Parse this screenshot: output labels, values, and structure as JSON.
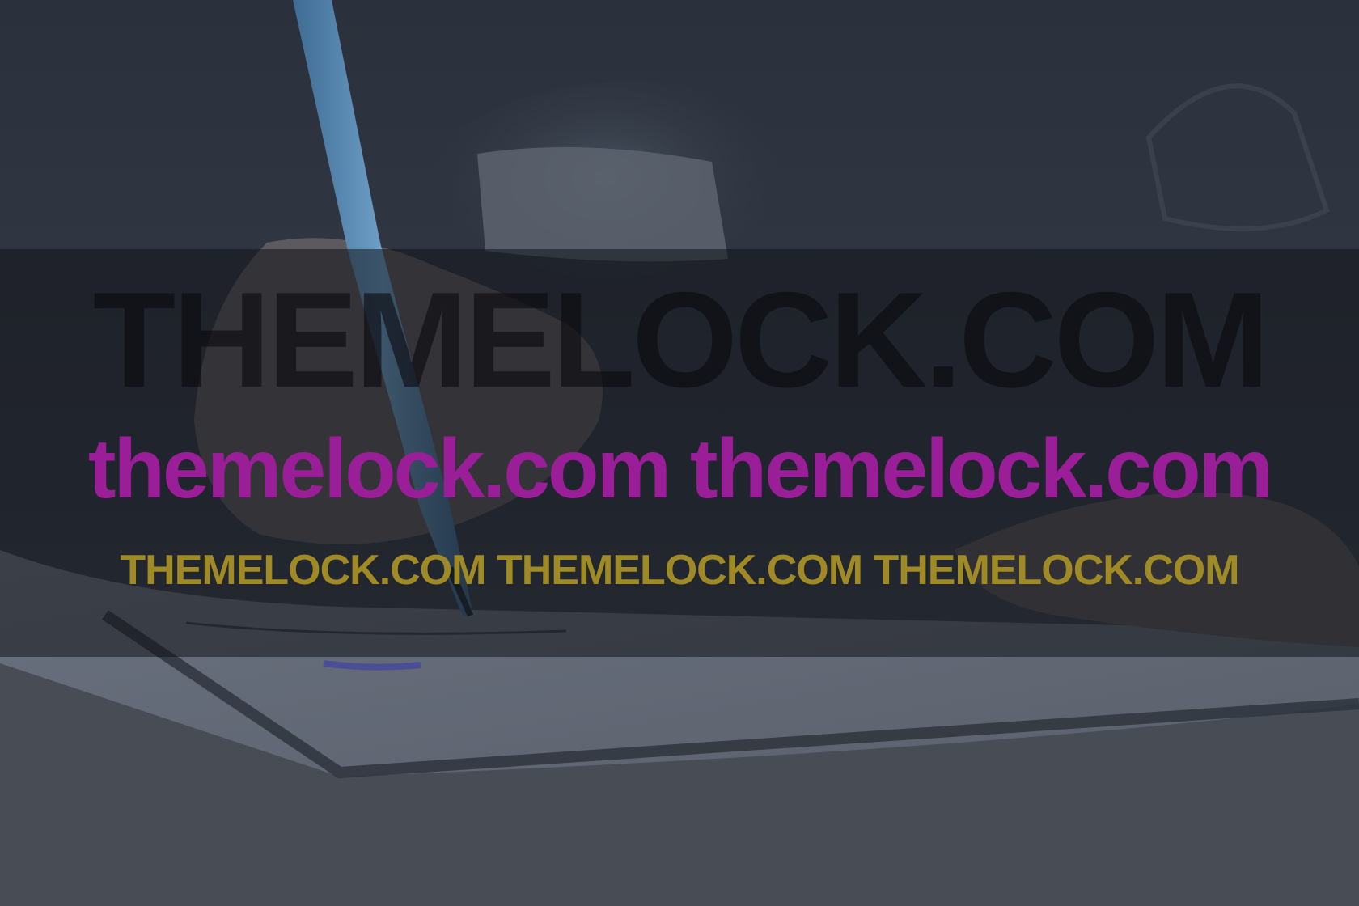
{
  "watermark": {
    "line_1": "THEMELOCK.COM",
    "line_2": "themelock.com themelock.com",
    "line_3": "THEMELOCK.COM THEMELOCK.COM THEMELOCK.COM",
    "colors": {
      "line_1": "#0b0b0e",
      "line_2": "#9b1e99",
      "line_3": "#a08a26",
      "band": "#101218"
    }
  },
  "photo": {
    "subject": "hand writing with blue pen on paper",
    "icon": "photo-background"
  }
}
